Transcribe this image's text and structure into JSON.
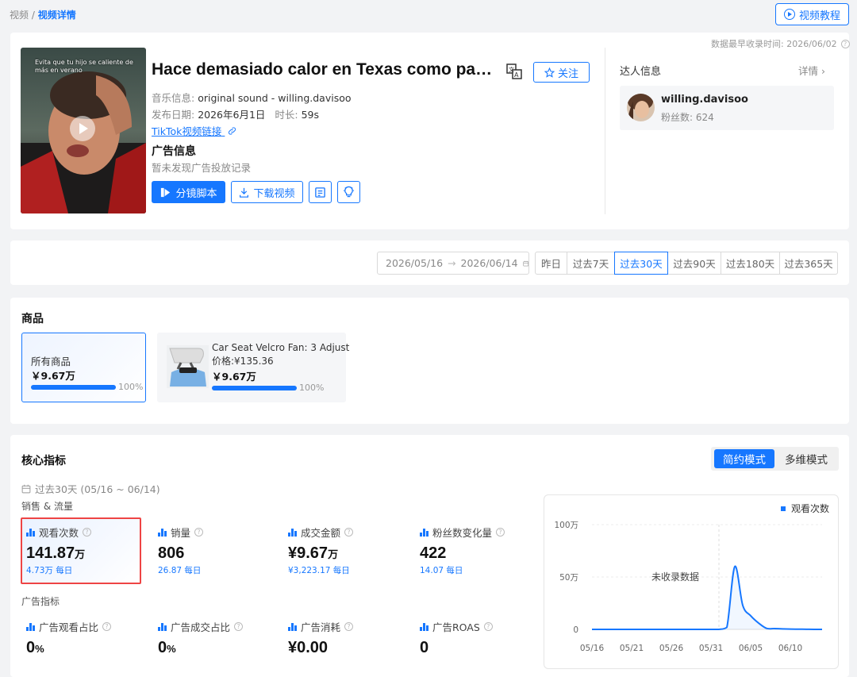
{
  "breadcrumb": {
    "parent": "视频",
    "sep": "/",
    "current": "视频详情"
  },
  "tutorial_label": "视频教程",
  "earliest_record": "数据最早收录时间: 2026/06/02",
  "video": {
    "caption": "Evita que tu hijo se caliente de más en verano",
    "title": "Hace demasiado calor en Texas como para...",
    "follow_label": "关注",
    "music_label": "音乐信息:",
    "music_value": "original sound - willing.davisoo",
    "date_label": "发布日期:",
    "date_value": "2026年6月1日",
    "duration_label": "时长:",
    "duration_value": "59s",
    "tiktok_link": "TikTok视频链接",
    "ad_heading": "广告信息",
    "ad_text": "暂未发现广告投放记录",
    "storyboard_label": "分镜脚本",
    "download_label": "下载视频"
  },
  "talent": {
    "heading": "达人信息",
    "detail": "详情",
    "name": "willing.davisoo",
    "fans": "粉丝数: 624"
  },
  "daterange": {
    "start": "2026/05/16",
    "end": "2026/06/14",
    "arrow": "→",
    "presets": [
      "昨日",
      "过去7天",
      "过去30天",
      "过去90天",
      "过去180天",
      "过去365天"
    ],
    "active_index": 2
  },
  "goods": {
    "heading": "商品",
    "all": {
      "label": "所有商品",
      "amount": "￥9.67万",
      "percent": "100%",
      "fraction": 1.0
    },
    "items": [
      {
        "name": "Car Seat Velcro Fan: 3 Adjust",
        "price": "价格:¥135.36",
        "amount": "￥9.67万",
        "percent": "100%",
        "fraction": 1.0
      }
    ]
  },
  "core": {
    "heading": "核心指标",
    "modes": [
      "简约模式",
      "多维模式"
    ],
    "period": "过去30天 (05/16 ~ 06/14)",
    "sales_section": "销售 & 流量",
    "ads_section": "广告指标",
    "sales": [
      {
        "label": "观看次数",
        "value": "141.87",
        "unit": "万",
        "daily": "4.73万 每日"
      },
      {
        "label": "销量",
        "value": "806",
        "unit": "",
        "daily": "26.87 每日"
      },
      {
        "label": "成交金额",
        "value": "¥9.67",
        "unit": "万",
        "daily": "¥3,223.17 每日"
      },
      {
        "label": "粉丝数变化量",
        "value": "422",
        "unit": "",
        "daily": "14.07 每日"
      }
    ],
    "ads": [
      {
        "label": "广告观看占比",
        "value": "0",
        "unit": "%"
      },
      {
        "label": "广告成交占比",
        "value": "0",
        "unit": "%"
      },
      {
        "label": "广告消耗",
        "value": "¥0.00",
        "unit": ""
      },
      {
        "label": "广告ROAS",
        "value": "0",
        "unit": ""
      }
    ]
  },
  "chart_data": {
    "type": "area",
    "legend": "观看次数",
    "legend_position": "top-right",
    "annotation": "未收录数据",
    "y_ticks": [
      "100万",
      "50万",
      "0"
    ],
    "x_ticks": [
      "05/16",
      "05/21",
      "05/26",
      "05/31",
      "06/05",
      "06/10"
    ],
    "ylim": [
      0,
      1000000
    ],
    "grid": true,
    "x": [
      "05/16",
      "05/17",
      "05/18",
      "05/19",
      "05/20",
      "05/21",
      "05/22",
      "05/23",
      "05/24",
      "05/25",
      "05/26",
      "05/27",
      "05/28",
      "05/29",
      "05/30",
      "05/31",
      "06/01",
      "06/02",
      "06/03",
      "06/04",
      "06/05",
      "06/06",
      "06/07",
      "06/08",
      "06/09",
      "06/10",
      "06/11",
      "06/12",
      "06/13",
      "06/14"
    ],
    "values": [
      0,
      0,
      0,
      0,
      0,
      0,
      0,
      0,
      0,
      0,
      0,
      0,
      0,
      0,
      0,
      0,
      0,
      20000,
      600000,
      230000,
      130000,
      60000,
      10000,
      8000,
      5000,
      3000,
      2000,
      1000,
      0,
      0
    ],
    "uncollected_until": "06/01"
  },
  "colors": {
    "accent": "#1677ff",
    "highlight": "#e44444"
  }
}
